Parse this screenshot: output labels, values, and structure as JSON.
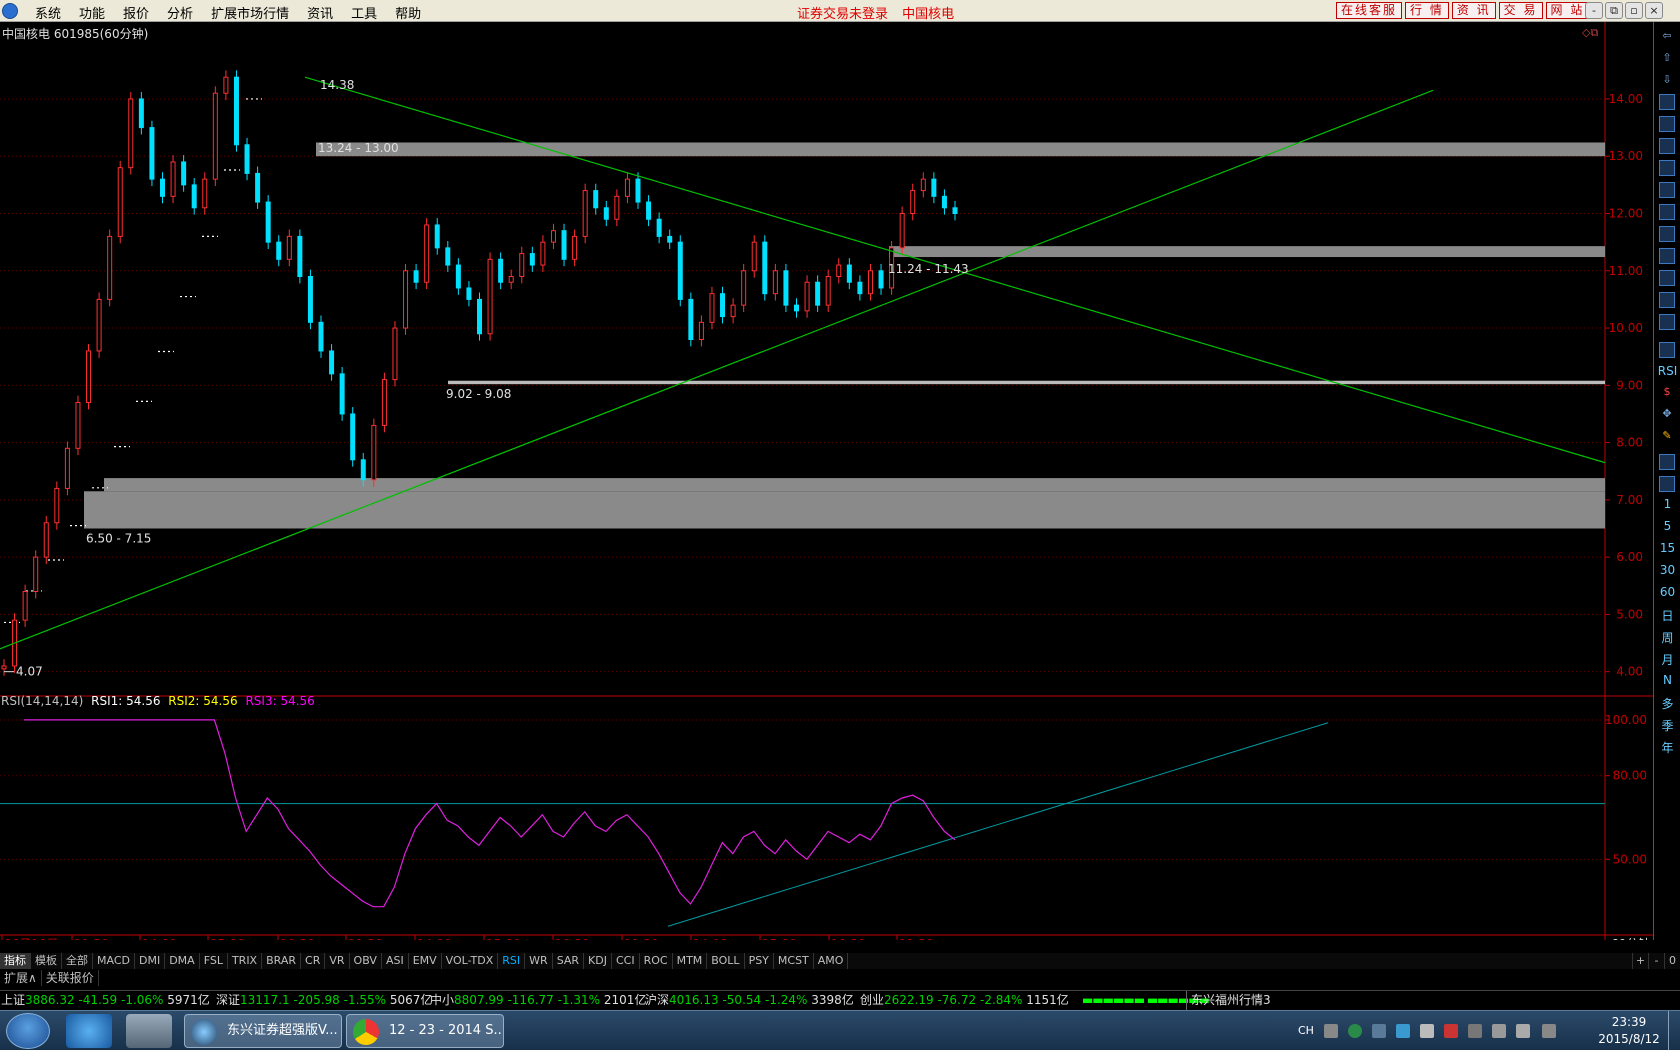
{
  "menu": [
    "系统",
    "功能",
    "报价",
    "分析",
    "扩展市场行情",
    "资讯",
    "工具",
    "帮助"
  ],
  "title_notice": [
    "证券交易未登录",
    "中国核电"
  ],
  "right_buttons": [
    "在线客服",
    "行 情",
    "资 讯",
    "交 易",
    "网 站"
  ],
  "window_controls": [
    "-",
    "⧉",
    "▫",
    "×"
  ],
  "chart_title": "中国核电  601985(60分钟)",
  "rsi_header": {
    "name": "RSI(14,14,14)",
    "rsi1": "RSI1: 54.56",
    "rsi2": "RSI2: 54.56",
    "rsi3": "RSI3: 54.56"
  },
  "colors": {
    "up": "#ff3030",
    "down": "#00e0ff",
    "trendline": "#00c000",
    "zone": "#8a8a8a",
    "rsi_line": "#e020e0",
    "rsi_trend": "#009aa0",
    "axis_red": "#c00000"
  },
  "zone_labels": [
    "13.24 - 13.00",
    "11.24 - 11.43",
    "9.02 - 9.08",
    "6.50 - 7.15"
  ],
  "price_labels": {
    "high": "14.38",
    "low": "4.07"
  },
  "chart_data": {
    "type": "candlestick",
    "period": "60分钟",
    "y_ticks": [
      "14.00",
      "13.00",
      "12.00",
      "11.00",
      "10.00",
      "9.00",
      "8.00",
      "7.00",
      "6.00",
      "5.00",
      "4.00"
    ],
    "ylim": [
      3.75,
      14.75
    ],
    "rsi_ticks": [
      "100.00",
      "80.00",
      "50.00"
    ],
    "rsi_ylim": [
      25,
      105
    ],
    "x_labels": [
      "06月10日",
      "11:30",
      "14:00",
      "15:00",
      "10:30",
      "11:30",
      "14:00",
      "15:00",
      "10:30",
      "11:30",
      "14:00",
      "15:00",
      "10:30",
      "11:30"
    ],
    "limit_dashes": [
      4.86,
      5.41,
      5.95,
      6.55,
      7.21,
      7.93,
      8.72,
      9.59,
      10.55,
      11.6,
      12.76,
      14.0
    ],
    "support_resistance_zones": [
      {
        "low": 13.0,
        "high": 13.24,
        "label": "13.24 - 13.00"
      },
      {
        "low": 11.24,
        "high": 11.43,
        "label": "11.24 - 11.43"
      },
      {
        "low": 9.02,
        "high": 9.08,
        "label": "9.02 - 9.08"
      },
      {
        "low": 6.5,
        "high": 7.15,
        "label": "6.50 - 7.15"
      },
      {
        "low": 7.15,
        "high": 7.38,
        "label": ""
      }
    ],
    "trendlines": [
      {
        "from": [
          0,
          4.4
        ],
        "to": [
          1433,
          14.15
        ]
      },
      {
        "from": [
          305,
          14.38
        ],
        "to": [
          1605,
          7.65
        ]
      }
    ],
    "candles_close": [
      4.1,
      4.9,
      5.4,
      6.0,
      6.6,
      7.2,
      7.9,
      8.7,
      9.6,
      10.5,
      11.6,
      12.8,
      14.0,
      13.5,
      12.6,
      12.3,
      12.9,
      12.5,
      12.1,
      12.6,
      14.1,
      14.38,
      13.2,
      12.7,
      12.2,
      11.5,
      11.2,
      11.6,
      10.9,
      10.1,
      9.6,
      9.2,
      8.5,
      7.7,
      7.35,
      8.3,
      9.1,
      10.0,
      11.0,
      10.8,
      11.8,
      11.4,
      11.1,
      10.7,
      10.5,
      9.9,
      11.2,
      10.8,
      10.9,
      11.3,
      11.1,
      11.5,
      11.7,
      11.2,
      11.6,
      12.4,
      12.1,
      11.9,
      12.3,
      12.6,
      12.2,
      11.9,
      11.6,
      11.5,
      10.5,
      9.8,
      10.1,
      10.6,
      10.2,
      10.4,
      11.0,
      11.5,
      10.6,
      11.0,
      10.4,
      10.3,
      10.8,
      10.4,
      10.9,
      11.1,
      10.8,
      10.6,
      11.0,
      10.7,
      11.4,
      12.0,
      12.4,
      12.6,
      12.3,
      12.1,
      12.0
    ],
    "rsi_values": [
      100,
      100,
      100,
      100,
      100,
      100,
      100,
      100,
      100,
      100,
      100,
      100,
      100,
      100,
      100,
      100,
      100,
      100,
      100,
      88,
      72,
      60,
      66,
      72,
      68,
      61,
      57,
      53,
      48,
      44,
      41,
      38,
      35,
      33,
      33,
      40,
      52,
      61,
      66,
      70,
      64,
      62,
      58,
      55,
      60,
      65,
      62,
      58,
      62,
      66,
      60,
      58,
      63,
      67,
      62,
      60,
      64,
      66,
      62,
      58,
      52,
      45,
      38,
      34,
      40,
      48,
      56,
      52,
      58,
      60,
      55,
      52,
      57,
      53,
      50,
      55,
      60,
      58,
      56,
      59,
      57,
      62,
      70,
      72,
      73,
      71,
      65,
      60,
      57
    ]
  },
  "right_toolbar_labels": [
    "RSI",
    "1",
    "5",
    "15",
    "30",
    "60",
    "日",
    "周",
    "月",
    "N",
    "多",
    "季",
    "年"
  ],
  "indicator_tabs": [
    "指标",
    "模板",
    "全部",
    "MACD",
    "DMI",
    "DMA",
    "FSL",
    "TRIX",
    "BRAR",
    "CR",
    "VR",
    "OBV",
    "ASI",
    "EMV",
    "VOL-TDX",
    "RSI",
    "WR",
    "SAR",
    "KDJ",
    "CCI",
    "ROC",
    "MTM",
    "BOLL",
    "PSY",
    "MCST",
    "AMO"
  ],
  "indicator_right": [
    "+",
    "-",
    "0"
  ],
  "sub_tabs": [
    "扩展∧",
    "关联报价"
  ],
  "period_label": "60分钟",
  "status_line": [
    {
      "name": "上证",
      "price": "3886.32",
      "change": "-41.59",
      "pct": "-1.06%",
      "vol": "5971亿"
    },
    {
      "name": "深证",
      "price": "13117.1",
      "change": "-205.98",
      "pct": "-1.55%",
      "vol": "5067亿"
    },
    {
      "name": "中小",
      "price": "8807.99",
      "change": "-116.77",
      "pct": "-1.31%",
      "vol": "2101亿"
    },
    {
      "name": "沪深",
      "price": "4016.13",
      "change": "-50.54",
      "pct": "-1.24%",
      "vol": "3398亿"
    },
    {
      "name": "创业",
      "price": "2622.19",
      "change": "-76.72",
      "pct": "-2.84%",
      "vol": "1151亿"
    }
  ],
  "status_market": "东兴福州行情3",
  "taskbar": {
    "tasks": [
      "东兴证券超强版V...",
      "12 - 23 - 2014 S..."
    ],
    "lang": "CH",
    "time": "23:39",
    "date": "2015/8/12"
  }
}
